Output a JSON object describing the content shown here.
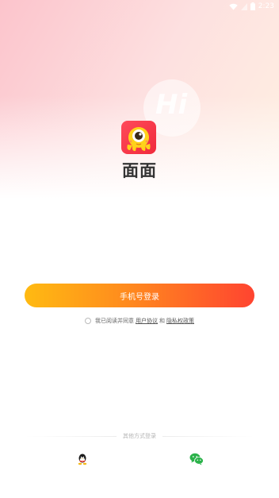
{
  "status_bar": {
    "time": "2:23",
    "icons": [
      "wifi-icon",
      "signal-icon",
      "battery-icon"
    ]
  },
  "decoration": {
    "hi_text": "Hi"
  },
  "app": {
    "name": "面面",
    "logo_icon": "octopus-mascot-icon"
  },
  "login": {
    "phone_button_label": "手机号登录"
  },
  "agreement": {
    "checked": false,
    "prefix": "我已阅读并同意",
    "user_agreement": "用户协议",
    "conjunction": "和",
    "privacy_policy": "隐私权政策"
  },
  "other_login": {
    "label": "其他方式登录",
    "options": [
      "qq-icon",
      "wechat-icon"
    ]
  },
  "colors": {
    "button_gradient_start": "#ffba12",
    "button_gradient_end": "#ff4430",
    "top_gradient_pink": "#fcc4cc",
    "top_gradient_peach": "#fff1e2",
    "app_name": "#333333"
  }
}
